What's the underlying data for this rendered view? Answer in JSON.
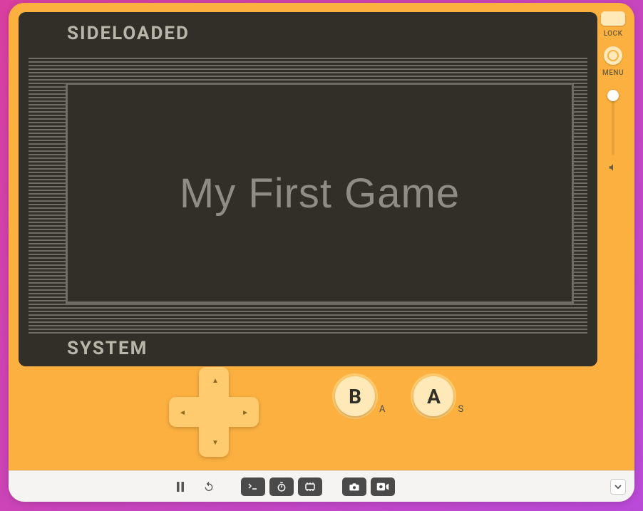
{
  "header_label": "SIDELOADED",
  "footer_label": "SYSTEM",
  "game_title": "My First Game",
  "side": {
    "lock_label": "LOCK",
    "menu_label": "MENU"
  },
  "buttons": {
    "b_label": "B",
    "b_key": "A",
    "a_label": "A",
    "a_key": "S"
  }
}
